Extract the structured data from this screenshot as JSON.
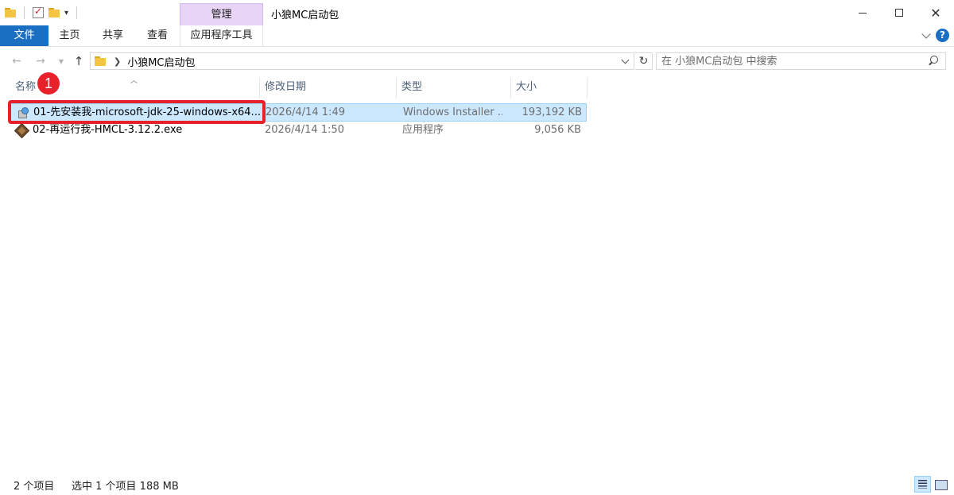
{
  "window": {
    "title": "小狼MC启动包",
    "contextual_tab_group": "管理"
  },
  "ribbon": {
    "tabs": [
      {
        "label": "文件"
      },
      {
        "label": "主页"
      },
      {
        "label": "共享"
      },
      {
        "label": "查看"
      },
      {
        "label": "应用程序工具"
      }
    ]
  },
  "nav": {
    "address_path": "小狼MC启动包",
    "search_placeholder": "在 小狼MC启动包 中搜索"
  },
  "columns": {
    "name": "名称",
    "date": "修改日期",
    "type": "类型",
    "size": "大小"
  },
  "files": [
    {
      "name": "01-先安装我-microsoft-jdk-25-windows-x64...",
      "date": "2026/4/14 1:49",
      "type": "Windows Installer ...",
      "size": "193,192 KB",
      "icon": "msi-installer-icon",
      "selected": true
    },
    {
      "name": "02-再运行我-HMCL-3.12.2.exe",
      "date": "2026/4/14 1:50",
      "type": "应用程序",
      "size": "9,056 KB",
      "icon": "hmcl-exe-icon",
      "selected": false
    }
  ],
  "annotation": {
    "badge_number": "1",
    "color": "#e8202a"
  },
  "status": {
    "item_count": "2 个项目",
    "selection": "选中 1 个项目  188 MB"
  },
  "colors": {
    "file_tab": "#1a6fc2",
    "manage_tab": "#e8d4f6",
    "selection_bg": "#cce8ff",
    "selection_border": "#99d1ff"
  }
}
